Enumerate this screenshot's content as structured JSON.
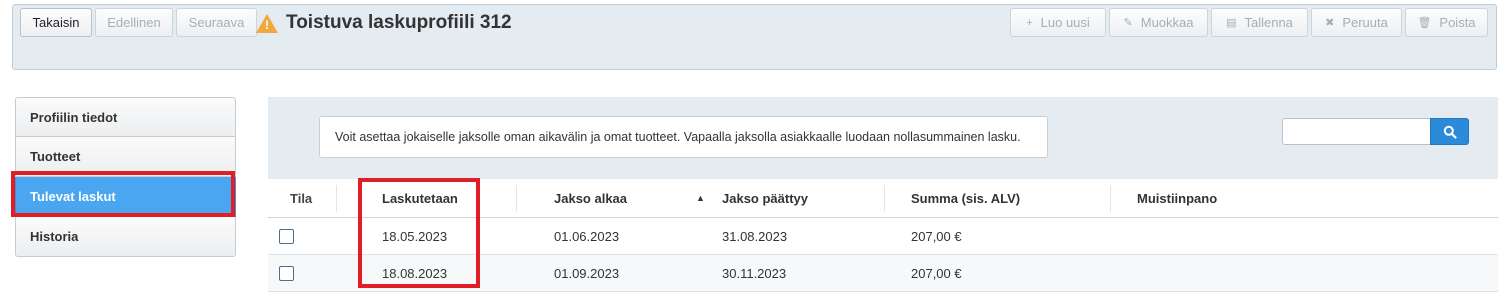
{
  "toolbar": {
    "back_label": "Takaisin",
    "prev_label": "Edellinen",
    "next_label": "Seuraava",
    "title": "Toistuva laskuprofiili 312",
    "create_label": "Luo uusi",
    "edit_label": "Muokkaa",
    "save_label": "Tallenna",
    "cancel_label": "Peruuta",
    "delete_label": "Poista"
  },
  "sidebar": {
    "items": [
      {
        "label": "Profiilin tiedot"
      },
      {
        "label": "Tuotteet"
      },
      {
        "label": "Tulevat laskut",
        "active": true
      },
      {
        "label": "Historia"
      }
    ]
  },
  "info": {
    "text": "Voit asettaa jokaiselle jaksolle oman aikavälin ja omat tuotteet. Vapaalla jaksolla asiakkaalle luodaan nollasummainen lasku."
  },
  "search": {
    "value": "",
    "placeholder": ""
  },
  "table": {
    "columns": {
      "status": "Tila",
      "billing_date": "Laskutetaan",
      "period_start": "Jakso alkaa",
      "period_end": "Jakso päättyy",
      "sum": "Summa (sis. ALV)",
      "note": "Muistiinpano"
    },
    "rows": [
      {
        "billing_date": "18.05.2023",
        "period_start": "01.06.2023",
        "period_end": "31.08.2023",
        "sum": "207,00 €",
        "note": ""
      },
      {
        "billing_date": "18.08.2023",
        "period_start": "01.09.2023",
        "period_end": "30.11.2023",
        "sum": "207,00 €",
        "note": ""
      }
    ]
  },
  "colors": {
    "accent": "#4aa6f0",
    "highlight": "#e01e26",
    "warning": "#f2a93b"
  }
}
